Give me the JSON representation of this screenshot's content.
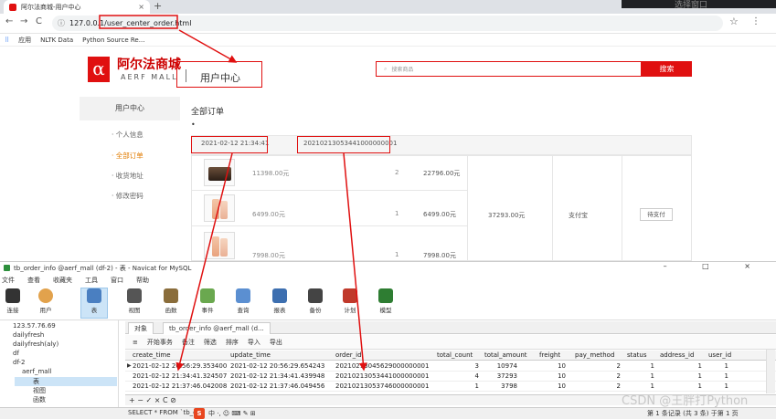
{
  "browser": {
    "tab_title": "阿尔法商城-用户中心",
    "tab_close": "×",
    "new_tab": "+",
    "corner_text": "选择窗口",
    "back": "←",
    "forward": "→",
    "reload": "C",
    "url": "127.0.0.1/user_center_order.html",
    "star": "☆",
    "menu": "⋮",
    "bookmarks": [
      "应用",
      "NLTK Data",
      "Python Source Re..."
    ]
  },
  "site": {
    "logo": "α",
    "brand_cn": "阿尔法商城",
    "brand_en": "AERF MALL",
    "center_title": "用户中心",
    "search_placeholder": "搜索商品",
    "search_button": "搜索"
  },
  "sidebar": {
    "header": "用户中心",
    "items": [
      "· 个人信息",
      "· 全部订单",
      "· 收货地址",
      "· 修改密码"
    ],
    "active_index": 1
  },
  "orders": {
    "title": "全部订单",
    "dot": "•",
    "create_time": "2021-02-12 21:34:41",
    "order_id": "20210213053441000000001",
    "items": [
      {
        "price": "11398.00元",
        "qty": "2",
        "subtotal": "22796.00元"
      },
      {
        "price": "6499.00元",
        "qty": "1",
        "subtotal": "6499.00元"
      },
      {
        "price": "7998.00元",
        "qty": "1",
        "subtotal": "7998.00元"
      }
    ],
    "total_amount": "37293.00元",
    "pay_method": "支付宝",
    "pay_button": "待支付"
  },
  "navicat": {
    "title": "tb_order_info @aerf_mall (df-2) - 表 - Navicat for MySQL",
    "window_buttons": "– □ ×",
    "menu": [
      "文件",
      "查看",
      "收藏夹",
      "工具",
      "窗口",
      "帮助"
    ],
    "toolbar": [
      "连接",
      "用户",
      "表",
      "视图",
      "函数",
      "事件",
      "查询",
      "报表",
      "备份",
      "计划",
      "模型"
    ],
    "tree": [
      "123.57.76.69",
      "dailyfresh",
      "dailyfresh(aly)",
      "df",
      "df-2",
      "aerf_mall",
      "表",
      "视图",
      "函数"
    ],
    "tabs": [
      "对象",
      "tb_order_info @aerf_mall (d..."
    ],
    "grid_toolbar": [
      "开始事务",
      "备注",
      "筛选",
      "排序",
      "导入",
      "导出"
    ],
    "columns": [
      "create_time",
      "update_time",
      "order_id",
      "total_count",
      "total_amount",
      "freight",
      "pay_method",
      "status",
      "address_id",
      "user_id"
    ],
    "rows": [
      [
        "2021-02-12 20:56:29.353400",
        "2021-02-12 20:56:29.654243",
        "20210213045629000000001",
        "3",
        "10974",
        "10",
        "2",
        "1",
        "1",
        "1"
      ],
      [
        "2021-02-12 21:34:41.324507",
        "2021-02-12 21:34:41.439948",
        "20210213053441000000001",
        "4",
        "37293",
        "10",
        "2",
        "1",
        "1",
        "1"
      ],
      [
        "2021-02-12 21:37:46.042008",
        "2021-02-12 21:37:46.049456",
        "20210213053746000000001",
        "1",
        "3798",
        "10",
        "2",
        "1",
        "1",
        "1"
      ]
    ],
    "bottom_controls": "+ − ✓ × C ⊘",
    "sql": "SELECT * FROM `tb_o",
    "record_count": "第 1 条记录 (共 3 条) 于第 1 页"
  },
  "watermark": "CSDN @王胖打Python",
  "colors": {
    "accent": "#e01010",
    "navicat_select": "#cce4f7"
  }
}
